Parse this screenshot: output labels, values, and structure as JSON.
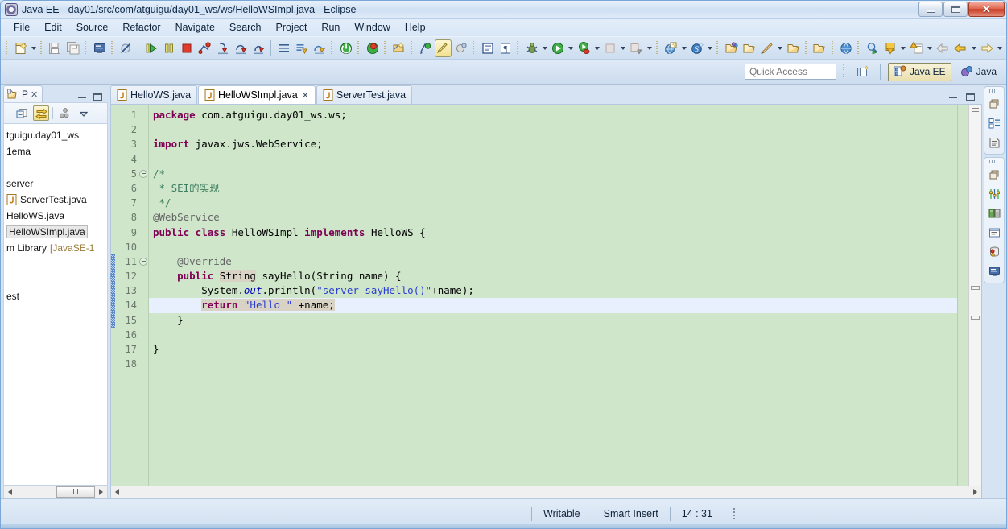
{
  "window": {
    "title": "Java EE - day01/src/com/atguigu/day01_ws/ws/HelloWSImpl.java - Eclipse",
    "app_icon": "eclipse-icon",
    "controls": {
      "minimize": "minimize-button",
      "maximize": "maximize-button",
      "close": "✕"
    }
  },
  "menubar": {
    "items": [
      {
        "label": "File"
      },
      {
        "label": "Edit"
      },
      {
        "label": "Source"
      },
      {
        "label": "Refactor"
      },
      {
        "label": "Navigate"
      },
      {
        "label": "Search"
      },
      {
        "label": "Project"
      },
      {
        "label": "Run"
      },
      {
        "label": "Window"
      },
      {
        "label": "Help"
      }
    ]
  },
  "toolbar": {
    "groups": [
      {
        "items": [
          {
            "icon": "new-wizard-icon"
          },
          {
            "icon": "dropdown-caret"
          }
        ]
      },
      {
        "items": [
          {
            "icon": "save-icon"
          },
          {
            "icon": "save-all-icon"
          }
        ]
      },
      {
        "items": [
          {
            "icon": "console-icon"
          }
        ]
      },
      {
        "items": [
          {
            "icon": "skip-breakpoints-icon"
          }
        ]
      },
      {
        "items": [
          {
            "icon": "resume-icon"
          },
          {
            "icon": "suspend-icon"
          },
          {
            "icon": "terminate-icon"
          },
          {
            "icon": "disconnect-icon"
          },
          {
            "icon": "step-into-icon"
          },
          {
            "icon": "step-over-icon"
          },
          {
            "icon": "step-return-icon"
          }
        ]
      },
      {
        "items": [
          {
            "icon": "menu-lines-icon"
          }
        ]
      },
      {
        "items": [
          {
            "icon": "publish-icon"
          },
          {
            "icon": "validate-icon"
          }
        ]
      },
      {
        "items": [
          {
            "icon": "server-start-icon"
          }
        ]
      },
      {
        "items": [
          {
            "icon": "server-debug-icon"
          }
        ]
      },
      {
        "items": [
          {
            "icon": "new-annotation-icon"
          }
        ]
      },
      {
        "items": [
          {
            "icon": "refresh-icon"
          }
        ]
      },
      {
        "items": [
          {
            "icon": "edit-highlight-icon",
            "selected": true
          }
        ]
      },
      {
        "items": [
          {
            "icon": "toggle-mark-occurrences-icon"
          }
        ]
      },
      {
        "items": [
          {
            "icon": "block-selection-icon"
          },
          {
            "icon": "whitespace-icon"
          }
        ]
      },
      {
        "items": [
          {
            "icon": "debug-bug-icon"
          },
          {
            "icon": "dropdown-caret"
          }
        ]
      },
      {
        "items": [
          {
            "icon": "run-icon"
          },
          {
            "icon": "dropdown-caret"
          }
        ]
      },
      {
        "items": [
          {
            "icon": "run-coverage-icon"
          },
          {
            "icon": "dropdown-caret"
          }
        ]
      },
      {
        "items": [
          {
            "icon": "stop-build-icon"
          },
          {
            "icon": "dropdown-caret"
          }
        ]
      },
      {
        "items": [
          {
            "icon": "external-tools-icon"
          },
          {
            "icon": "dropdown-caret"
          }
        ]
      },
      {
        "items": [
          {
            "icon": "new-web-project-icon"
          },
          {
            "icon": "dropdown-caret"
          }
        ]
      },
      {
        "items": [
          {
            "icon": "new-spring-bean-icon"
          },
          {
            "icon": "dropdown-caret"
          }
        ]
      },
      {
        "items": [
          {
            "icon": "open-type-icon"
          },
          {
            "icon": "open-folder-icon"
          },
          {
            "icon": "pencil-icon"
          },
          {
            "icon": "dropdown-caret"
          },
          {
            "icon": "open-package-icon"
          }
        ]
      },
      {
        "items": [
          {
            "icon": "open-resource-icon"
          }
        ]
      },
      {
        "items": [
          {
            "icon": "search-globe-icon"
          }
        ]
      },
      {
        "items": [
          {
            "icon": "search-run-icon"
          }
        ]
      },
      {
        "items": [
          {
            "icon": "next-annotation-icon"
          },
          {
            "icon": "dropdown-caret"
          },
          {
            "icon": "previous-annotation-icon"
          },
          {
            "icon": "dropdown-caret"
          }
        ]
      },
      {
        "items": [
          {
            "icon": "back-arrow-icon"
          },
          {
            "icon": "forward-back-icon"
          },
          {
            "icon": "dropdown-caret"
          },
          {
            "icon": "forward-arrow-icon"
          },
          {
            "icon": "dropdown-caret"
          }
        ]
      }
    ]
  },
  "quick_access": {
    "placeholder": "Quick Access",
    "value": "",
    "open_perspective_icon": "open-perspective-icon",
    "perspectives": [
      {
        "label": "Java EE",
        "icon": "java-ee-perspective-icon",
        "active": true
      },
      {
        "label": "Java",
        "icon": "java-perspective-icon",
        "active": false
      }
    ]
  },
  "explorer": {
    "tab": {
      "label": "P",
      "icon": "package-explorer-icon",
      "close": "✕"
    },
    "controls": {
      "minimize": "minimize-view-button",
      "maximize": "maximize-view-button"
    },
    "toolbar": [
      {
        "icon": "collapse-all-icon",
        "selected": false
      },
      {
        "icon": "link-with-editor-icon",
        "selected": true
      },
      {
        "icon": "view-menu-hierarchy-icon",
        "selected": false
      },
      {
        "icon": "view-menu-icon",
        "selected": false
      }
    ],
    "tree": [
      {
        "label": "tguigu.day01_ws",
        "icon": "package-icon",
        "indent": 0,
        "selected": false
      },
      {
        "label": "1ema",
        "icon": "none",
        "indent": 0,
        "selected": false
      },
      {
        "label": "",
        "icon": "none",
        "indent": 0,
        "selected": false
      },
      {
        "label": "server",
        "icon": "none",
        "indent": 1,
        "selected": false
      },
      {
        "label": "ServerTest.java",
        "icon": "java-file-icon",
        "indent": 1,
        "selected": false
      },
      {
        "label": "HelloWS.java",
        "icon": "none",
        "indent": 1,
        "selected": false
      },
      {
        "label": "HelloWSImpl.java",
        "icon": "none",
        "indent": 1,
        "selected": true
      },
      {
        "label": "m Library ",
        "suffix": "[JavaSE-1",
        "icon": "none",
        "indent": 0,
        "selected": false
      },
      {
        "label": "",
        "icon": "none",
        "indent": 0,
        "selected": false
      },
      {
        "label": "",
        "icon": "none",
        "indent": 0,
        "selected": false
      },
      {
        "label": "est",
        "icon": "none",
        "indent": 0,
        "selected": false
      }
    ],
    "hscroll": {
      "left_arrow": "scroll-left-arrow",
      "right_arrow": "scroll-right-arrow"
    }
  },
  "editor": {
    "tabs": [
      {
        "label": "HelloWS.java",
        "icon": "java-file-icon",
        "active": false,
        "closable": false
      },
      {
        "label": "HelloWSImpl.java",
        "icon": "java-file-icon",
        "active": true,
        "closable": true,
        "close": "✕"
      },
      {
        "label": "ServerTest.java",
        "icon": "java-file-icon",
        "active": false,
        "closable": false
      }
    ],
    "controls": {
      "minimize": "minimize-editor-button",
      "maximize": "maximize-editor-button"
    },
    "first_line": 1,
    "lines": [
      {
        "n": 1,
        "fold": false,
        "changed": false,
        "highlight": false,
        "tokens": [
          {
            "t": "package ",
            "c": "kw"
          },
          {
            "t": "com.atguigu.day01_ws.ws;",
            "c": ""
          }
        ]
      },
      {
        "n": 2,
        "fold": false,
        "changed": false,
        "highlight": false,
        "tokens": []
      },
      {
        "n": 3,
        "fold": false,
        "changed": false,
        "highlight": false,
        "tokens": [
          {
            "t": "import ",
            "c": "kw"
          },
          {
            "t": "javax.jws.WebService;",
            "c": ""
          }
        ]
      },
      {
        "n": 4,
        "fold": false,
        "changed": false,
        "highlight": false,
        "tokens": []
      },
      {
        "n": 5,
        "fold": true,
        "changed": false,
        "highlight": false,
        "tokens": [
          {
            "t": "/*",
            "c": "cmt"
          }
        ]
      },
      {
        "n": 6,
        "fold": false,
        "changed": false,
        "highlight": false,
        "tokens": [
          {
            "t": " * SEI的实现",
            "c": "cmt"
          }
        ]
      },
      {
        "n": 7,
        "fold": false,
        "changed": false,
        "highlight": false,
        "tokens": [
          {
            "t": " */",
            "c": "cmt"
          }
        ]
      },
      {
        "n": 8,
        "fold": false,
        "changed": false,
        "highlight": false,
        "tokens": [
          {
            "t": "@WebService",
            "c": "ann"
          }
        ]
      },
      {
        "n": 9,
        "fold": false,
        "changed": false,
        "highlight": false,
        "tokens": [
          {
            "t": "public class ",
            "c": "kw"
          },
          {
            "t": "HelloWSImpl ",
            "c": ""
          },
          {
            "t": "implements ",
            "c": "kw"
          },
          {
            "t": "HelloWS {",
            "c": ""
          }
        ]
      },
      {
        "n": 10,
        "fold": false,
        "changed": false,
        "highlight": false,
        "tokens": []
      },
      {
        "n": 11,
        "fold": true,
        "changed": true,
        "highlight": false,
        "tokens": [
          {
            "t": "    @Override",
            "c": "ann"
          }
        ]
      },
      {
        "n": 12,
        "fold": false,
        "changed": true,
        "highlight": false,
        "qdiff": true,
        "tokens": [
          {
            "t": "    ",
            "c": ""
          },
          {
            "t": "public ",
            "c": "kw"
          },
          {
            "t": "String",
            "c": "occ"
          },
          {
            "t": " sayHello(String name) {",
            "c": ""
          }
        ]
      },
      {
        "n": 13,
        "fold": false,
        "changed": true,
        "highlight": false,
        "tokens": [
          {
            "t": "        System.",
            "c": ""
          },
          {
            "t": "out",
            "c": "fld"
          },
          {
            "t": ".println(",
            "c": ""
          },
          {
            "t": "\"server sayHello()\"",
            "c": "str"
          },
          {
            "t": "+name);",
            "c": ""
          }
        ]
      },
      {
        "n": 14,
        "fold": false,
        "changed": true,
        "highlight": true,
        "tokens": [
          {
            "t": "        ",
            "c": ""
          },
          {
            "t": "return ",
            "c": "kw occ"
          },
          {
            "t": "\"Hello \"",
            "c": "str occ"
          },
          {
            "t": " +name;",
            "c": "occ"
          }
        ]
      },
      {
        "n": 15,
        "fold": false,
        "changed": true,
        "highlight": false,
        "tokens": [
          {
            "t": "    }",
            "c": ""
          }
        ]
      },
      {
        "n": 16,
        "fold": false,
        "changed": false,
        "highlight": false,
        "tokens": []
      },
      {
        "n": 17,
        "fold": false,
        "changed": false,
        "highlight": false,
        "tokens": [
          {
            "t": "}",
            "c": ""
          }
        ]
      },
      {
        "n": 18,
        "fold": false,
        "changed": false,
        "highlight": false,
        "tokens": []
      }
    ],
    "colors": {
      "background": "#cfe6cb",
      "highlight_line": "#e8f0fe",
      "keyword": "#7f0055",
      "string": "#2a3ed4",
      "comment": "#3f7f5f",
      "annotation": "#646464",
      "field": "#0000c0",
      "occurrence": "#d8d3c4"
    }
  },
  "fastview": {
    "groups": [
      {
        "icons": [
          "restore-view-icon",
          "outline-view-icon",
          "task-list-icon"
        ]
      },
      {
        "icons": [
          "restore-view-icon",
          "properties-view-icon",
          "servers-view-icon",
          "snippets-view-icon",
          "data-source-explorer-icon",
          "console-view-icon"
        ]
      }
    ]
  },
  "statusbar": {
    "writable": "Writable",
    "insert_mode": "Smart Insert",
    "cursor_position": "14 : 31"
  }
}
